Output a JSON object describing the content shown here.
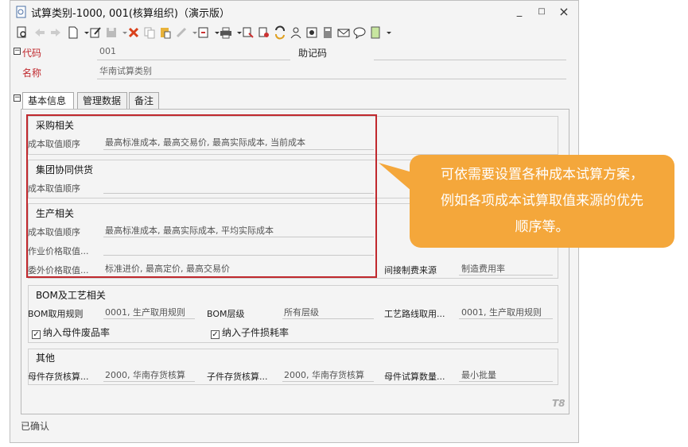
{
  "window": {
    "title": "试算类别-1000, 001(核算组织)（演示版）",
    "minimize": "_",
    "maximize": "□",
    "close": "×"
  },
  "header": {
    "code_label": "代码",
    "code_value": "001",
    "mnemonic_label": "助记码",
    "name_label": "名称",
    "name_value": "华南试算类别"
  },
  "tabs": [
    {
      "label": "基本信息"
    },
    {
      "label": "管理数据"
    },
    {
      "label": "备注"
    }
  ],
  "purchase": {
    "title": "采购相关",
    "cost_order_label": "成本取值顺序",
    "cost_order_value": "最高标准成本, 最高交易价, 最高实际成本, 当前成本"
  },
  "group_supply": {
    "title": "集团协同供货",
    "cost_order_label": "成本取值顺序",
    "cost_order_value": ""
  },
  "production": {
    "title": "生产相关",
    "cost_order_label": "成本取值顺序",
    "cost_order_value": "最高标准成本, 最高实际成本, 平均实际成本",
    "op_price_label": "作业价格取值...",
    "op_price_value": "",
    "outsource_label": "委外价格取值...",
    "outsource_value": "标准进价, 最高定价, 最高交易价",
    "indirect_label": "间接制费来源",
    "indirect_value": "制造费用率"
  },
  "bom": {
    "title": "BOM及工艺相关",
    "rule_label": "BOM取用规则",
    "rule_value": "0001, 生产取用规则",
    "level_label": "BOM层级",
    "level_value": "所有层级",
    "route_label": "工艺路线取用...",
    "route_value": "0001, 生产取用规则",
    "chk_parent": "纳入母件废品率",
    "chk_child": "纳入子件损耗率"
  },
  "other": {
    "title": "其他",
    "parent_inv_label": "母件存货核算...",
    "parent_inv_value": "2000, 华南存货核算",
    "child_inv_label": "子件存货核算...",
    "child_inv_value": "2000, 华南存货核算",
    "parent_qty_label": "母件试算数量...",
    "parent_qty_value": "最小批量"
  },
  "watermark": "T8",
  "status": "已确认",
  "callout": {
    "line1": "可依需要设置各种成本试算方案，",
    "line2": "例如各项成本试算取值来源的优先",
    "line3": "顺序等。"
  },
  "colors": {
    "highlight_border": "#c0282d",
    "callout_bg": "#f4a73b"
  }
}
